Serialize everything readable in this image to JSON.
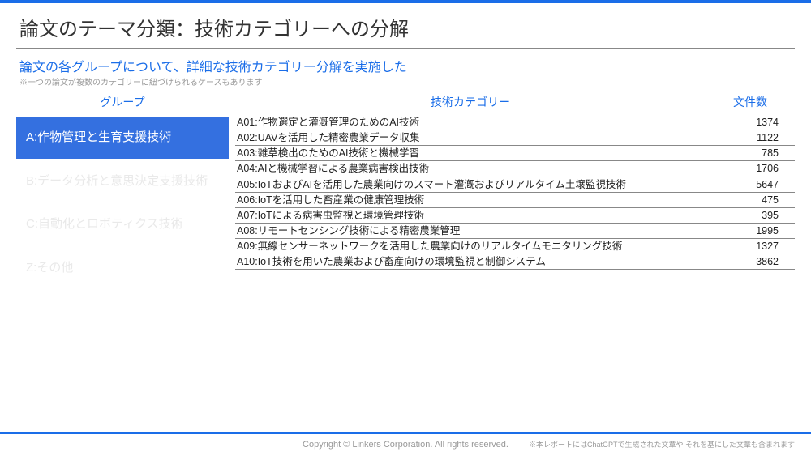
{
  "title": "論文のテーマ分類：技術カテゴリーへの分解",
  "subtitle": "論文の各グループについて、詳細な技術カテゴリー分解を実施した",
  "note": "※一つの論文が複数のカテゴリーに紐づけられるケースもあります",
  "headers": {
    "group": "グループ",
    "category": "技術カテゴリー",
    "count": "文件数"
  },
  "groups": [
    {
      "label": "A:作物管理と生育支援技術",
      "active": true
    },
    {
      "label": "B:データ分析と意思決定支援技術",
      "active": false
    },
    {
      "label": "C:自動化とロボティクス技術",
      "active": false
    },
    {
      "label": "Z:その他",
      "active": false
    }
  ],
  "rows": [
    {
      "label": "A01:作物選定と灌漑管理のためのAI技術",
      "count": "1374"
    },
    {
      "label": "A02:UAVを活用した精密農業データ収集",
      "count": "1122"
    },
    {
      "label": "A03:雑草検出のためのAI技術と機械学習",
      "count": "785"
    },
    {
      "label": "A04:AIと機械学習による農業病害検出技術",
      "count": "1706"
    },
    {
      "label": "A05:IoTおよびAIを活用した農業向けのスマート灌漑およびリアルタイム土壌監視技術",
      "count": "5647"
    },
    {
      "label": "A06:IoTを活用した畜産業の健康管理技術",
      "count": "475"
    },
    {
      "label": "A07:IoTによる病害虫監視と環境管理技術",
      "count": "395"
    },
    {
      "label": "A08:リモートセンシング技術による精密農業管理",
      "count": "1995"
    },
    {
      "label": "A09:無線センサーネットワークを活用した農業向けのリアルタイムモニタリング技術",
      "count": "1327"
    },
    {
      "label": "A10:IoT技術を用いた農業および畜産向けの環境監視と制御システム",
      "count": "3862"
    }
  ],
  "footer": {
    "copy": "Copyright © Linkers Corporation. All rights reserved.",
    "right": "※本レポートにはChatGPTで生成された文章や それを基にした文章も含まれます"
  }
}
